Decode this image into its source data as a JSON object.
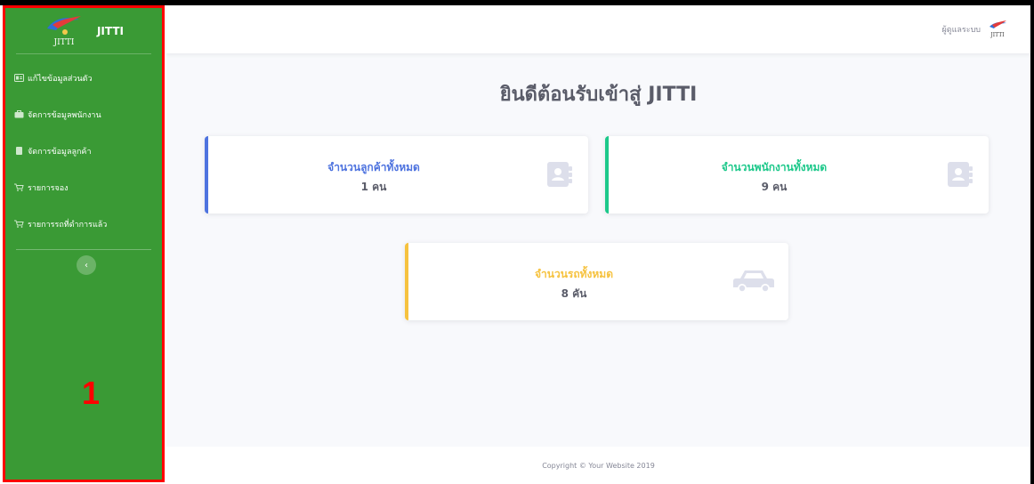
{
  "brand": {
    "name": "JITTI",
    "logo_text": "JITTI"
  },
  "sidebar": {
    "items": [
      {
        "label": "แก้ไขข้อมูลส่วนตัว",
        "icon": "id-card-icon"
      },
      {
        "label": "จัดการข้อมูลพนักงาน",
        "icon": "briefcase-icon"
      },
      {
        "label": "จัดการข้อมูลลูกค้า",
        "icon": "file-icon"
      },
      {
        "label": "รายการจอง",
        "icon": "cart-icon"
      },
      {
        "label": "รายการรถที่ดำการแล้ว",
        "icon": "cart-icon"
      }
    ],
    "toggle_glyph": "‹",
    "annotation_number": "1"
  },
  "topbar": {
    "user_label": "ผู้ดูแลระบบ"
  },
  "main": {
    "title": "ยินดีต้อนรับเข้าสู่ JITTI",
    "cards": [
      {
        "label": "จำนวนลูกค้าทั้งหมด",
        "value": "1 คน",
        "color": "#4e73df",
        "icon": "address-book-icon"
      },
      {
        "label": "จำนวนพนักงานทั้งหมด",
        "value": "9 คน",
        "color": "#1cc88a",
        "icon": "address-book-icon"
      },
      {
        "label": "จำนวนรถทั้งหมด",
        "value": "8 คัน",
        "color": "#f6c23e",
        "icon": "car-icon"
      }
    ]
  },
  "footer": {
    "text": "Copyright © Your Website 2019"
  },
  "colors": {
    "sidebar_bg": "#3a9a35",
    "highlight_border": "#ff0000",
    "icon_gray": "#dddfeb"
  }
}
